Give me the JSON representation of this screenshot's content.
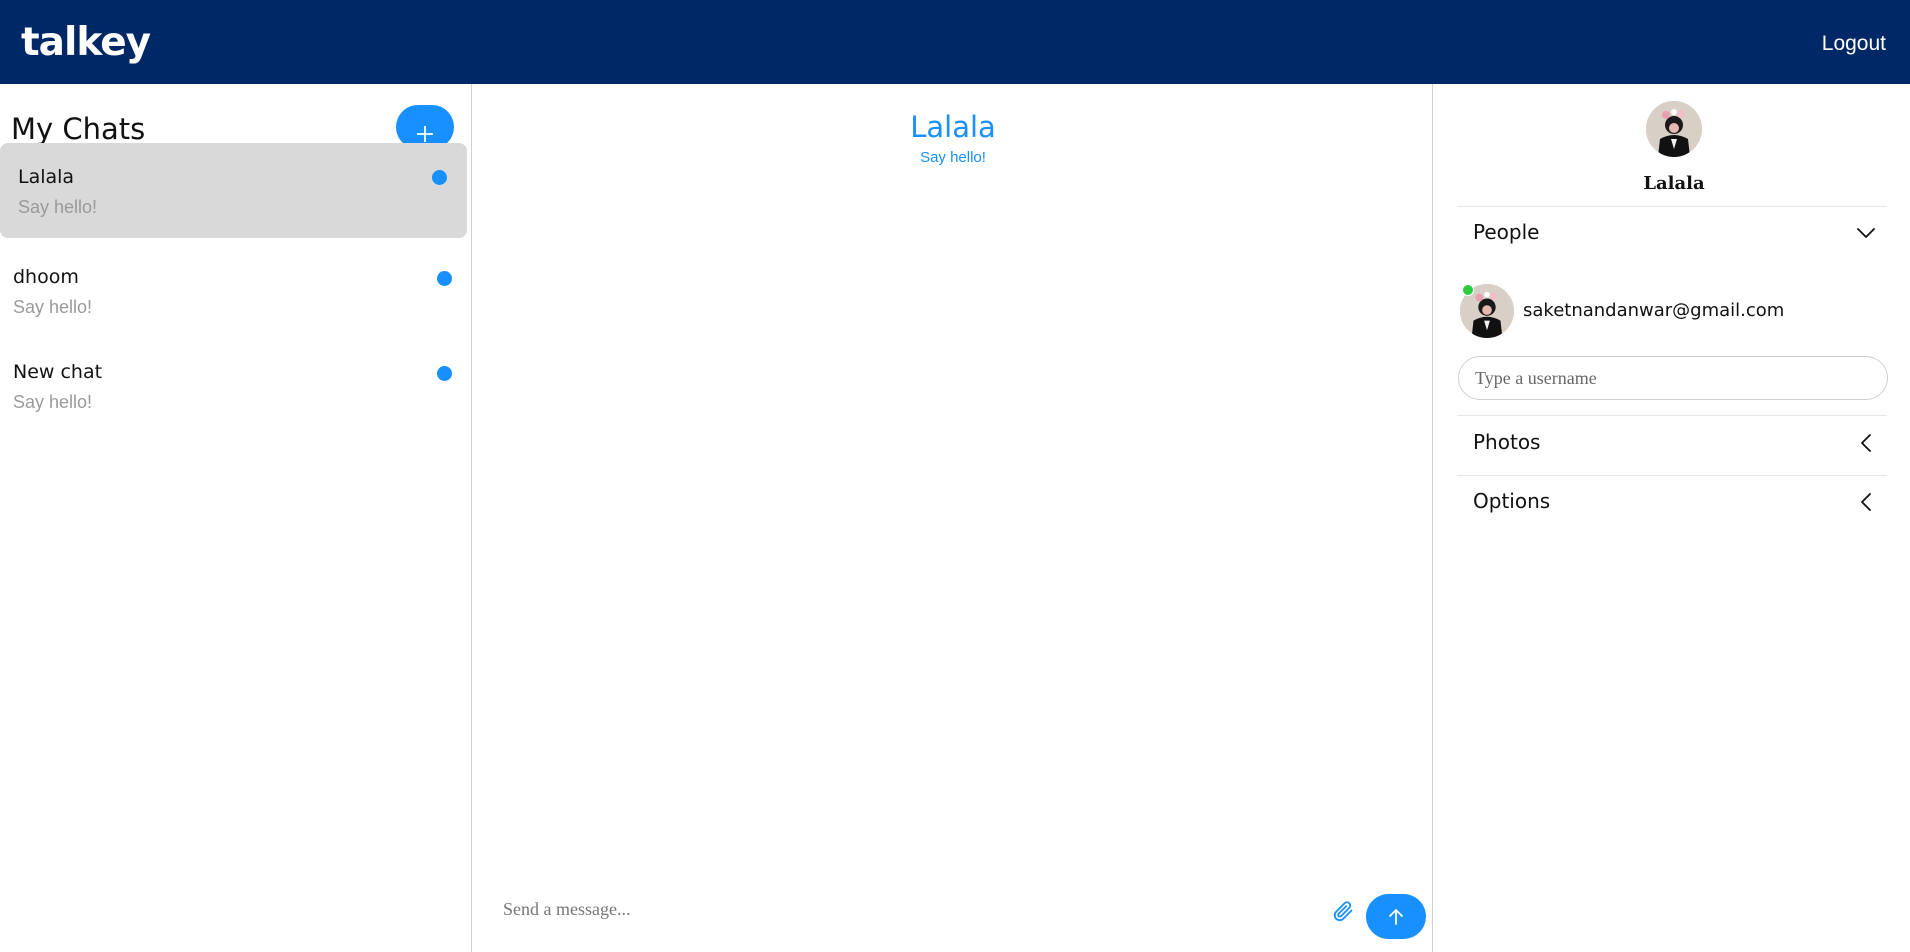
{
  "app": {
    "brand": "talkey",
    "logout_label": "Logout"
  },
  "sidebar": {
    "title": "My Chats",
    "add_button_icon": "plus-icon",
    "chats": [
      {
        "title": "Lalala",
        "subtitle": "Say hello!",
        "active": true
      },
      {
        "title": "dhoom",
        "subtitle": "Say hello!",
        "active": false
      },
      {
        "title": "New chat",
        "subtitle": "Say hello!",
        "active": false
      }
    ]
  },
  "conversation": {
    "title": "Lalala",
    "subtitle": "Say hello!",
    "message_placeholder": "Send a message...",
    "attach_icon": "paperclip-icon",
    "send_icon": "arrow-up-icon"
  },
  "settings": {
    "chat_name": "Lalala",
    "sections": {
      "people": "People",
      "photos": "Photos",
      "options": "Options"
    },
    "people": [
      {
        "email": "saketnandanwar@gmail.com",
        "online": true
      }
    ],
    "username_placeholder": "Type a username"
  },
  "colors": {
    "header": "#002766",
    "accent": "#1890ff",
    "active_chat": "#d9d9d9",
    "online": "#2ecc40"
  }
}
